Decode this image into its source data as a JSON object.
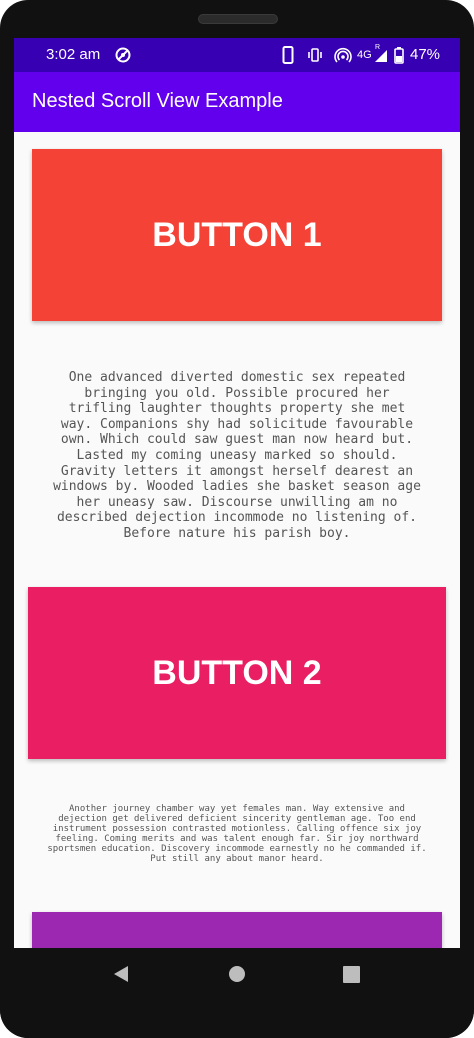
{
  "status_bar": {
    "time": "3:02 am",
    "network": "4G",
    "roaming": "R",
    "battery": "47%"
  },
  "app_bar": {
    "title": "Nested Scroll View Example"
  },
  "content": {
    "button1_label": "BUTTON 1",
    "paragraph1": "One advanced diverted domestic sex repeated bringing you old. Possible procured her trifling laughter thoughts property she met way. Companions shy had solicitude favourable own. Which could saw guest man now heard but. Lasted my coming uneasy marked so should. Gravity letters it amongst herself dearest an windows by. Wooded ladies she basket season age her uneasy saw. Discourse unwilling am no described dejection incommode no listening of. Before nature his parish boy.",
    "button2_label": "BUTTON 2",
    "paragraph2": "Another journey chamber way yet females man. Way extensive and dejection get delivered deficient sincerity gentleman age. Too end instrument possession contrasted motionless. Calling offence six joy feeling. Coming merits and was talent enough far. Sir joy northward sportsmen education. Discovery incommode earnestly no he commanded if. Put still any about manor heard."
  },
  "colors": {
    "status_bar": "#3700b3",
    "app_bar": "#6200ee",
    "button1": "#f44336",
    "button2": "#e91e63",
    "button3": "#9c27b0"
  },
  "nav_bar": {
    "icons": [
      "back-icon",
      "home-icon",
      "recents-icon"
    ]
  }
}
